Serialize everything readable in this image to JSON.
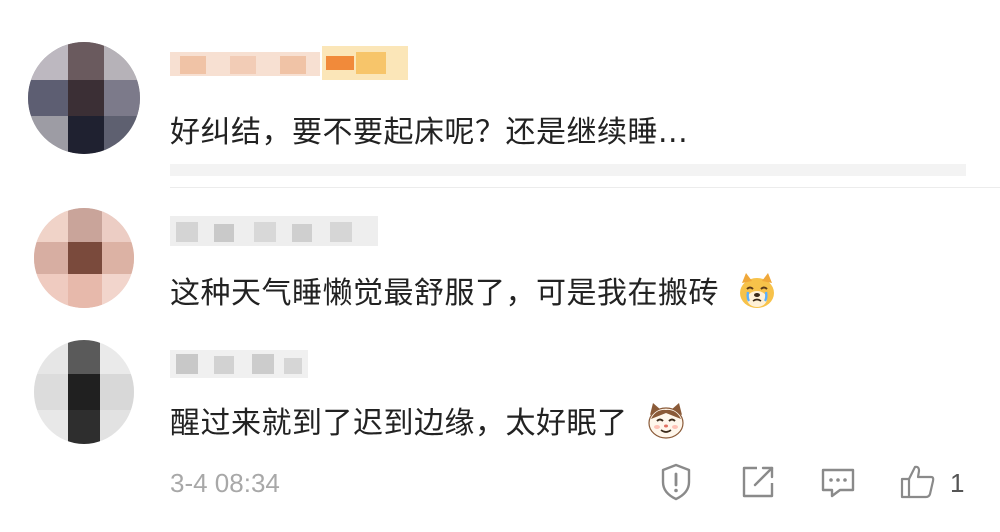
{
  "comments": [
    {
      "username": "",
      "text": "好纠结，要不要起床呢？还是继续睡..."
    },
    {
      "username": "",
      "text": "这种天气睡懒觉最舒服了，可是我在搬砖",
      "emoji": "dog-crying-icon"
    },
    {
      "username": "",
      "text": "醒过来就到了迟到边缘，太好眠了",
      "emoji": "cat-face-icon",
      "timestamp": "3-4 08:34",
      "like_count": "1"
    }
  ],
  "actions": [
    "report-icon",
    "share-icon",
    "reply-icon",
    "like-icon"
  ]
}
